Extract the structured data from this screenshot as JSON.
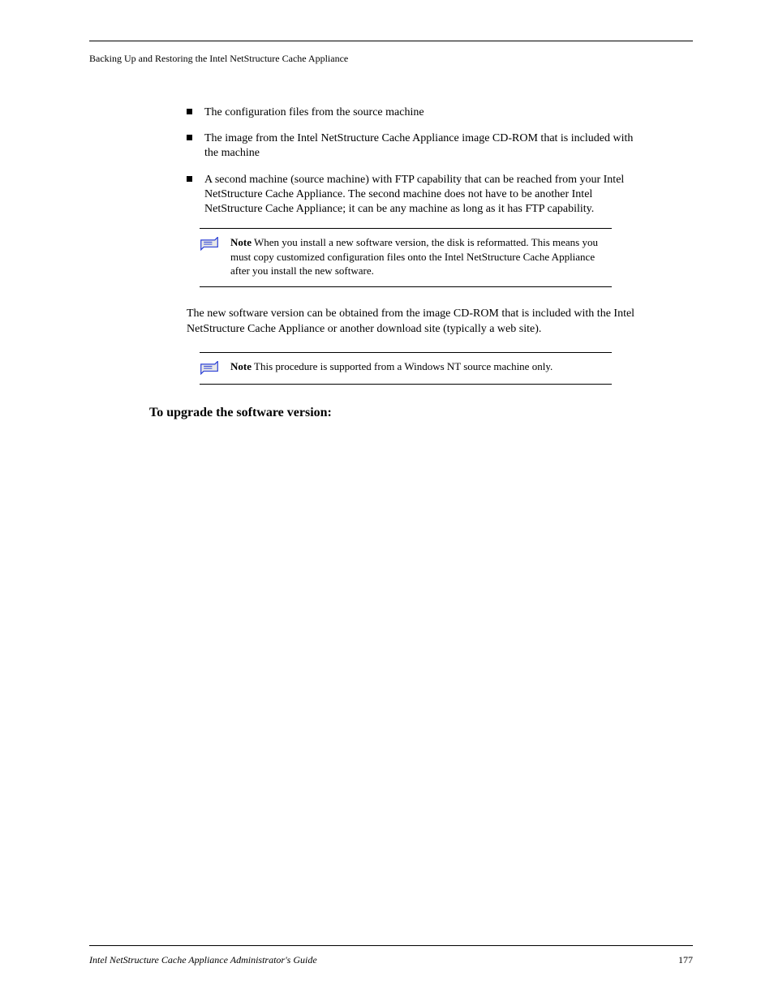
{
  "header": {
    "running": "Backing Up and Restoring the Intel NetStructure Cache Appliance"
  },
  "bullets": [
    "The configuration files from the source machine",
    "The image from the Intel NetStructure Cache Appliance image CD-ROM that is included with the machine",
    "A second machine (source machine) with FTP capability that can be reached from your Intel NetStructure Cache Appliance. The second machine does not have to be another Intel NetStructure Cache Appliance; it can be any machine as long as it has FTP capability."
  ],
  "notes": {
    "0": {
      "label": "Note",
      "text": "When you install a new software version, the disk is reformatted. This means you must copy customized configuration files onto the Intel NetStructure Cache Appliance after you install the new software."
    },
    "1": {
      "label": "Note",
      "text": "This procedure is supported from a Windows NT source machine only."
    }
  },
  "para_after_note1": "The new software version can be obtained from the image CD-ROM that is included with the Intel NetStructure Cache Appliance or another download site (typically a web site).",
  "heading": "To upgrade the software version:",
  "footer": {
    "product": "Intel NetStructure Cache Appliance Administrator's Guide",
    "page": "177"
  }
}
